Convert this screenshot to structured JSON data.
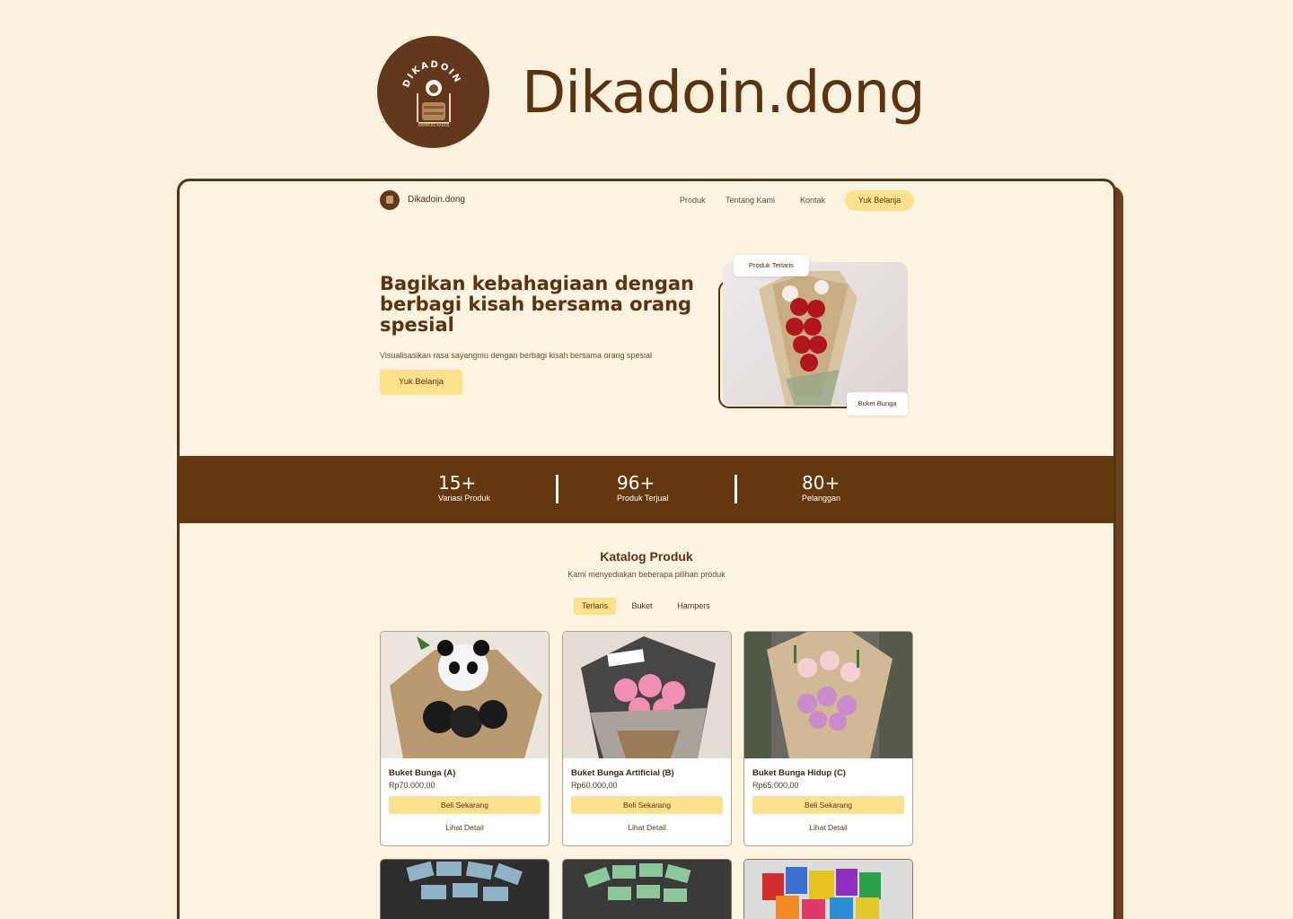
{
  "brand": {
    "name": "Dikadoin.dong",
    "logo_text": "DIKADOIN",
    "logo_subtext": "HAMPERS KADOS"
  },
  "nav": {
    "brand": "Dikadoin.dong",
    "links": [
      "Produk",
      "Tentang Kami",
      "Kontak"
    ],
    "cta": "Yuk Belanja"
  },
  "hero": {
    "title": "Bagikan kebahagiaan dengan berbagi kisah bersama orang spesial",
    "subtitle": "Visualisasikan rasa sayangmu dengan berbagi kisah bersama orang spesial",
    "cta": "Yuk Belanja",
    "tag_top": "Produk Terlaris",
    "tag_bottom": "Buket Bunga"
  },
  "stats": [
    {
      "value": "15+",
      "label": "Variasi Produk"
    },
    {
      "value": "96+",
      "label": "Produk Terjual"
    },
    {
      "value": "80+",
      "label": "Pelanggan"
    }
  ],
  "catalog": {
    "title": "Katalog Produk",
    "subtitle": "Kami menyediakan beberapa pilihan produk",
    "tabs": [
      "Terlaris",
      "Buket",
      "Hampers"
    ],
    "active_tab": "Terlaris",
    "products": [
      {
        "name": "Buket Bunga (A)",
        "price": "Rp70.000,00",
        "buy": "Beli Sekarang",
        "detail": "Lihat Detail"
      },
      {
        "name": "Buket Bunga Artificial (B)",
        "price": "Rp60.000,00",
        "buy": "Beli Sekarang",
        "detail": "Lihat Detail"
      },
      {
        "name": "Buket Bunga Hidup (C)",
        "price": "Rp65.000,00",
        "buy": "Beli Sekarang",
        "detail": "Lihat Detail"
      }
    ]
  },
  "colors": {
    "brown": "#5b3310",
    "cream": "#faf2df",
    "yellow": "#fde08c"
  }
}
